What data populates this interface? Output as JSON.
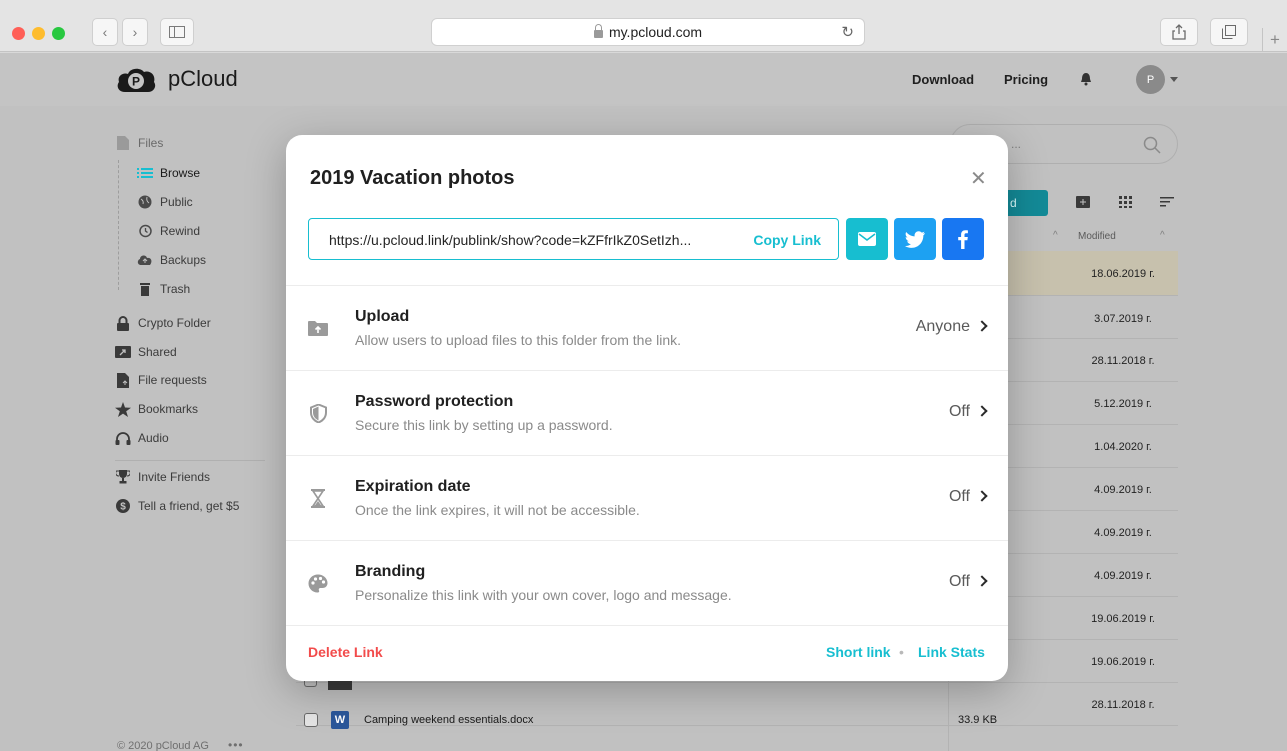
{
  "browser": {
    "url": "my.pcloud.com"
  },
  "header": {
    "brand": "pCloud",
    "download_label": "Download",
    "pricing_label": "Pricing",
    "avatar_initial": "P"
  },
  "sidebar": {
    "items": [
      {
        "label": "Files"
      },
      {
        "label": "Browse"
      },
      {
        "label": "Public"
      },
      {
        "label": "Rewind"
      },
      {
        "label": "Backups"
      },
      {
        "label": "Trash"
      },
      {
        "label": "Crypto Folder"
      },
      {
        "label": "Shared"
      },
      {
        "label": "File requests"
      },
      {
        "label": "Bookmarks"
      },
      {
        "label": "Audio"
      },
      {
        "label": "Invite Friends"
      },
      {
        "label": "Tell a friend, get $5"
      }
    ],
    "footer": "© 2020 pCloud AG"
  },
  "file_list": {
    "search_placeholder": "...",
    "upload_button_partial": "d",
    "modified_header": "Modified",
    "dates": [
      "18.06.2019 г.",
      "3.07.2019 г.",
      "28.11.2018 г.",
      "5.12.2019 г.",
      "1.04.2020 г.",
      "4.09.2019 г.",
      "4.09.2019 г.",
      "4.09.2019 г.",
      "19.06.2019 г.",
      "19.06.2019 г.",
      "28.11.2018 г."
    ],
    "visible_row": {
      "name": "Camping weekend essentials.docx",
      "size": "33.9 KB"
    }
  },
  "modal": {
    "title": "2019 Vacation photos",
    "link_url": "https://u.pcloud.link/publink/show?code=kZFfrIkZ0SetIzh...",
    "copy_label": "Copy Link",
    "options": [
      {
        "title": "Upload",
        "desc": "Allow users to upload files to this folder from the link.",
        "value": "Anyone"
      },
      {
        "title": "Password protection",
        "desc": "Secure this link by setting up a password.",
        "value": "Off"
      },
      {
        "title": "Expiration date",
        "desc": "Once the link expires, it will not be accessible.",
        "value": "Off"
      },
      {
        "title": "Branding",
        "desc": "Personalize this link with your own cover, logo and message.",
        "value": "Off"
      }
    ],
    "delete_label": "Delete Link",
    "short_link_label": "Short link",
    "separator": "•",
    "link_stats_label": "Link Stats"
  },
  "colors": {
    "accent": "#17bed0",
    "danger": "#f24b4b",
    "twitter": "#1da1f2",
    "facebook": "#1877f2"
  }
}
